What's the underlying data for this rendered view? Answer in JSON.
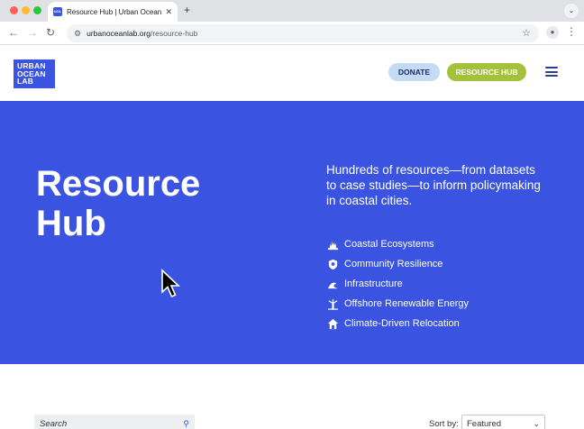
{
  "browser": {
    "tab_title": "Resource Hub | Urban Ocean Lab",
    "tab_close": "✕",
    "new_tab": "+",
    "url_host": "urbanoceanlab.org",
    "url_path": "/resource-hub"
  },
  "site": {
    "logo_lines": [
      "URBAN",
      "OCEAN",
      "LAB"
    ],
    "donate_label": "DONATE",
    "hub_label": "RESOURCE HUB"
  },
  "hero": {
    "title_line1": "Resource",
    "title_line2": "Hub",
    "description": "Hundreds of resources—from datasets to case studies—to inform policymaking in coastal cities.",
    "topics": [
      {
        "label": "Coastal Ecosystems",
        "icon": "coral-icon"
      },
      {
        "label": "Community Resilience",
        "icon": "shield-icon"
      },
      {
        "label": "Infrastructure",
        "icon": "wave-building-icon"
      },
      {
        "label": "Offshore Renewable Energy",
        "icon": "wind-turbine-icon"
      },
      {
        "label": "Climate-Driven Relocation",
        "icon": "house-icon"
      }
    ]
  },
  "filters": {
    "search_placeholder": "Search",
    "sort_label": "Sort by:",
    "sort_value": "Featured"
  },
  "colors": {
    "brand_blue": "#3a54e1",
    "lime": "#a3c23a",
    "donate_bg": "#c4dcf3"
  }
}
